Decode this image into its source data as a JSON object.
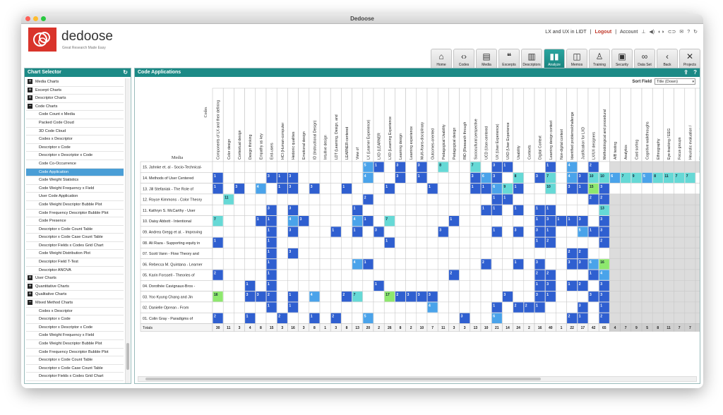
{
  "window": {
    "title": "Dedoose"
  },
  "brand": {
    "name": "dedoose",
    "tagline": "Great Research Made Easy"
  },
  "user": {
    "project": "LX and UX in LIDT",
    "logout": "Logout",
    "account": "Account"
  },
  "nav": [
    {
      "label": "Home",
      "icon": "home-icon",
      "glyph": "⌂"
    },
    {
      "label": "Codes",
      "icon": "codes-icon",
      "glyph": "‹›"
    },
    {
      "label": "Media",
      "icon": "media-icon",
      "glyph": "▤"
    },
    {
      "label": "Excerpts",
      "icon": "quote-icon",
      "glyph": "❝"
    },
    {
      "label": "Descriptors",
      "icon": "clipboard-icon",
      "glyph": "▥"
    },
    {
      "label": "Analyze",
      "icon": "bar-chart-icon",
      "glyph": "▮▮",
      "active": true
    },
    {
      "label": "Memos",
      "icon": "memo-icon",
      "glyph": "◫"
    },
    {
      "label": "Training",
      "icon": "training-icon",
      "glyph": "♙"
    },
    {
      "label": "Security",
      "icon": "lock-icon",
      "glyph": "▣"
    },
    {
      "label": "Data Set",
      "icon": "binoculars-icon",
      "glyph": "∞"
    },
    {
      "label": "Back",
      "icon": "back-icon",
      "glyph": "‹"
    },
    {
      "label": "Projects",
      "icon": "projects-icon",
      "glyph": "✕"
    }
  ],
  "left": {
    "title": "Chart Selector",
    "items": [
      {
        "t": "Media Charts",
        "g": "+"
      },
      {
        "t": "Excerpt Charts",
        "g": "+"
      },
      {
        "t": "Descriptor Charts",
        "g": "+"
      },
      {
        "t": "Code Charts",
        "g": "−"
      },
      {
        "t": "Code Count x Media"
      },
      {
        "t": "Packed Code Cloud"
      },
      {
        "t": "3D Code Cloud"
      },
      {
        "t": "Codes x Descriptor"
      },
      {
        "t": "Descriptor x Code"
      },
      {
        "t": "Descriptor x Descriptor x Code"
      },
      {
        "t": "Code Co-Occurrence"
      },
      {
        "t": "Code Application",
        "sel": true
      },
      {
        "t": "Code Weight Statistics"
      },
      {
        "t": "Code Weight Frequency x Field"
      },
      {
        "t": "User Code Application"
      },
      {
        "t": "Code Weight Descriptor Bubble Plot"
      },
      {
        "t": "Code Frequency Descriptor Bubble Plot"
      },
      {
        "t": "Code Presence"
      },
      {
        "t": "Descriptor x Code Count Table"
      },
      {
        "t": "Descriptor x Code Case Count Table"
      },
      {
        "t": "Descriptor Fields x Codes Grid Chart"
      },
      {
        "t": "Code Weight Distribution Plot"
      },
      {
        "t": "Descriptor Field T-Test"
      },
      {
        "t": "Descriptor ANOVA"
      },
      {
        "t": "User Charts",
        "g": "+"
      },
      {
        "t": "Quantitative Charts",
        "g": "+"
      },
      {
        "t": "Qualitative Charts",
        "g": "+"
      },
      {
        "t": "Mixed Method Charts",
        "g": "−"
      },
      {
        "t": "Codes x Descriptor"
      },
      {
        "t": "Descriptor x Code"
      },
      {
        "t": "Descriptor x Descriptor x Code"
      },
      {
        "t": "Code Weight Frequency x Field"
      },
      {
        "t": "Code Weight Descriptor Bubble Plot"
      },
      {
        "t": "Code Frequency Descriptor Bubble Plot"
      },
      {
        "t": "Descriptor x Code Count Table"
      },
      {
        "t": "Descriptor x Code Case Count Table"
      },
      {
        "t": "Descriptor Fields x Codes Grid Chart"
      }
    ]
  },
  "main": {
    "title": "Code Applications",
    "sort_label": "Sort Field",
    "sort_value": "Title (Down)",
    "axis_codes": "Codes",
    "axis_media": "Media",
    "totals_label": "Totals",
    "codes": [
      "Components of LX and their defining",
      "Color design",
      "Contextual design",
      "Design thinking",
      "Empathy as key",
      "End-users",
      "HCI (Human-computer",
      "Hedonic qualities",
      "Emotional design",
      "ID (Instructional Design)",
      "Intuitive design",
      "LDT (Learning, Design, and",
      "LEARNER-centered",
      "View of",
      "LX (Learner Experience)",
      "LXD (LEARNER",
      "LXD (Learning Experience",
      "Learning design",
      "Learning experience",
      "Multi-/trans-disciplinary",
      "Outcomes-oriented",
      "Pedagogical Usability",
      "Pedagogical design",
      "RtD (Research through",
      "Sociocultural perspective",
      "UCD (User-centered",
      "UX (User Experience)",
      "UXD (User Experience",
      "Usability",
      "Contexts",
      "Digital Context",
      "Learning design context",
      "Non-digital context",
      "Identified problems/challenge",
      "Justification for LXD",
      "LX/UX designers",
      "Methodological and procedural",
      "A/B testing",
      "Analytics",
      "Card sorting",
      "Cognitive walkthroughs",
      "Ethnography",
      "Eye-tracking / EEG",
      "Focus groups",
      "Heuristic evaluation /",
      "Needs assessment"
    ],
    "media": [
      "15. Jahnke et. al - Socio-Technical-",
      "14. Methods of User Centered",
      "13. Jill Stefaniak - The Role of",
      "12. Royce Kimmons - Color Theory",
      "11. Kathryn S. McCarthy - User",
      "10. Daisy Abbott - Intentional",
      "09. Andrea Gregg et al. - Improving",
      "08. Ali Raza - Supporting equity in",
      "07. Scott Vann - Flow Theory and",
      "06. Rebecca M. Quintana - Learner",
      "05. Karin Forssell - Theories  of",
      "04. Dorothée Cavignaux-Bros -",
      "03. Yoo Kyung Chang and Jin",
      "02. Danielle Oprean - From",
      "01. Colin Gray - Paradigms of"
    ],
    "cells": [
      [
        [
          14,
          "5"
        ],
        [
          15,
          "1"
        ],
        [
          17,
          "3"
        ],
        [
          19,
          "3"
        ],
        [
          21,
          "8"
        ],
        [
          24,
          "7"
        ],
        [
          26,
          "3"
        ],
        [
          27,
          "1"
        ],
        [
          31,
          "1"
        ],
        [
          33,
          "4"
        ],
        [
          35,
          "2"
        ]
      ],
      [
        [
          0,
          "1"
        ],
        [
          5,
          "3"
        ],
        [
          6,
          "1"
        ],
        [
          7,
          "3"
        ],
        [
          14,
          "4"
        ],
        [
          17,
          "3"
        ],
        [
          19,
          "1"
        ],
        [
          24,
          "3"
        ],
        [
          25,
          "6"
        ],
        [
          26,
          "3"
        ],
        [
          28,
          "8"
        ],
        [
          30,
          "3"
        ],
        [
          31,
          "7"
        ],
        [
          33,
          "4"
        ],
        [
          34,
          "3"
        ],
        [
          35,
          "10"
        ],
        [
          36,
          "10"
        ],
        [
          37,
          "6"
        ],
        [
          38,
          "7"
        ],
        [
          39,
          "9"
        ],
        [
          40,
          "5"
        ],
        [
          41,
          "8"
        ],
        [
          42,
          "11"
        ],
        [
          43,
          "7"
        ],
        [
          44,
          "7"
        ]
      ],
      [
        [
          0,
          "1"
        ],
        [
          2,
          "3"
        ],
        [
          4,
          "4"
        ],
        [
          6,
          "1"
        ],
        [
          7,
          "3"
        ],
        [
          9,
          "3"
        ],
        [
          12,
          "1"
        ],
        [
          16,
          "1"
        ],
        [
          20,
          "1"
        ],
        [
          24,
          "1"
        ],
        [
          25,
          "1"
        ],
        [
          26,
          "6"
        ],
        [
          27,
          "9"
        ],
        [
          28,
          "1"
        ],
        [
          31,
          "10"
        ],
        [
          33,
          "3"
        ],
        [
          34,
          "1"
        ],
        [
          35,
          "15"
        ],
        [
          36,
          "3"
        ]
      ],
      [
        [
          1,
          "11"
        ],
        [
          14,
          "2"
        ],
        [
          26,
          "1"
        ],
        [
          27,
          "1"
        ],
        [
          35,
          "2"
        ],
        [
          36,
          "2"
        ]
      ],
      [
        [
          5,
          "3"
        ],
        [
          7,
          "3"
        ],
        [
          13,
          "1"
        ],
        [
          25,
          "1"
        ],
        [
          26,
          "1"
        ],
        [
          28,
          "1"
        ],
        [
          30,
          "1"
        ],
        [
          31,
          "1"
        ],
        [
          36,
          "13"
        ]
      ],
      [
        [
          0,
          "7"
        ],
        [
          4,
          "1"
        ],
        [
          5,
          "1"
        ],
        [
          7,
          "4"
        ],
        [
          8,
          "3"
        ],
        [
          13,
          "4"
        ],
        [
          14,
          "1"
        ],
        [
          16,
          "7"
        ],
        [
          22,
          "1"
        ],
        [
          30,
          "1"
        ],
        [
          31,
          "3"
        ],
        [
          32,
          "1"
        ],
        [
          33,
          "1"
        ],
        [
          34,
          "3"
        ],
        [
          36,
          "3"
        ]
      ],
      [
        [
          5,
          "1"
        ],
        [
          7,
          "3"
        ],
        [
          11,
          "1"
        ],
        [
          13,
          "1"
        ],
        [
          15,
          "3"
        ],
        [
          21,
          "3"
        ],
        [
          26,
          "1"
        ],
        [
          28,
          "3"
        ],
        [
          30,
          "3"
        ],
        [
          31,
          "1"
        ],
        [
          34,
          "5"
        ],
        [
          35,
          "1"
        ],
        [
          36,
          "3"
        ]
      ],
      [
        [
          0,
          "1"
        ],
        [
          5,
          "1"
        ],
        [
          16,
          "1"
        ],
        [
          30,
          "1"
        ],
        [
          31,
          "2"
        ],
        [
          36,
          "2"
        ]
      ],
      [
        [
          5,
          "1"
        ],
        [
          7,
          "3"
        ],
        [
          33,
          "2"
        ],
        [
          34,
          "2"
        ]
      ],
      [
        [
          5,
          "1"
        ],
        [
          13,
          "4"
        ],
        [
          14,
          "1"
        ],
        [
          25,
          "2"
        ],
        [
          28,
          "1"
        ],
        [
          30,
          "3"
        ],
        [
          33,
          "3"
        ],
        [
          34,
          "3"
        ],
        [
          35,
          "6"
        ],
        [
          36,
          "16"
        ]
      ],
      [
        [
          0,
          "2"
        ],
        [
          5,
          "1"
        ],
        [
          22,
          "2"
        ],
        [
          30,
          "2"
        ],
        [
          31,
          "2"
        ],
        [
          35,
          "1"
        ],
        [
          36,
          "4"
        ]
      ],
      [
        [
          3,
          "1"
        ],
        [
          5,
          "1"
        ],
        [
          15,
          "1"
        ],
        [
          30,
          "1"
        ],
        [
          31,
          "3"
        ],
        [
          33,
          "1"
        ],
        [
          34,
          "2"
        ],
        [
          36,
          "3"
        ]
      ],
      [
        [
          0,
          "16"
        ],
        [
          3,
          "3"
        ],
        [
          4,
          "3"
        ],
        [
          5,
          "2"
        ],
        [
          7,
          "1"
        ],
        [
          9,
          "4"
        ],
        [
          12,
          "2"
        ],
        [
          13,
          "7"
        ],
        [
          16,
          "17"
        ],
        [
          17,
          "2"
        ],
        [
          18,
          "3"
        ],
        [
          19,
          "3"
        ],
        [
          20,
          "3"
        ],
        [
          27,
          "3"
        ],
        [
          30,
          "3"
        ],
        [
          31,
          "1"
        ],
        [
          35,
          "3"
        ],
        [
          36,
          "3"
        ]
      ],
      [
        [
          5,
          "1"
        ],
        [
          7,
          "1"
        ],
        [
          20,
          "4"
        ],
        [
          26,
          "1"
        ],
        [
          28,
          "2"
        ],
        [
          29,
          "2"
        ],
        [
          30,
          "1"
        ],
        [
          34,
          "3"
        ],
        [
          36,
          "1"
        ]
      ],
      [
        [
          0,
          "2"
        ],
        [
          3,
          "1"
        ],
        [
          6,
          "2"
        ],
        [
          9,
          "1"
        ],
        [
          11,
          "2"
        ],
        [
          14,
          "5"
        ],
        [
          23,
          "3"
        ],
        [
          26,
          "6"
        ],
        [
          33,
          "2"
        ],
        [
          34,
          "1"
        ],
        [
          36,
          "2"
        ]
      ]
    ],
    "totals": [
      "30",
      "11",
      "3",
      "4",
      "8",
      "15",
      "3",
      "16",
      "3",
      "8",
      "1",
      "3",
      "8",
      "13",
      "20",
      "2",
      "26",
      "8",
      "2",
      "10",
      "7",
      "11",
      "3",
      "3",
      "13",
      "10",
      "21",
      "14",
      "24",
      "2",
      "16",
      "40",
      "1",
      "22",
      "17",
      "42",
      "65",
      "4",
      "7",
      "9",
      "5",
      "8",
      "11",
      "7",
      "7",
      "1"
    ],
    "colors": {
      "low": "#2f5fd0",
      "mid": "#4aa3ea",
      "high": "#66d9d6",
      "top": "#8ee86e",
      "cell_empty": "#ffffff",
      "cell_shade": "#dcdcdc"
    }
  }
}
